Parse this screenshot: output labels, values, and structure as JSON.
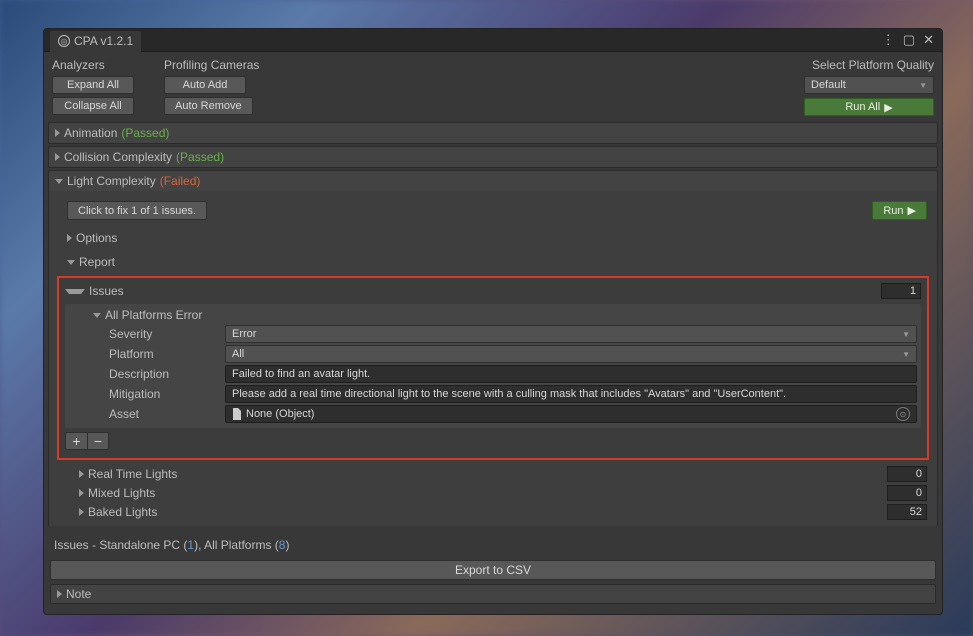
{
  "window": {
    "title": "CPA v1.2.1"
  },
  "toolbar": {
    "analyzers_label": "Analyzers",
    "profiling_label": "Profiling Cameras",
    "expand_all": "Expand All",
    "collapse_all": "Collapse All",
    "auto_add": "Auto Add",
    "auto_remove": "Auto Remove",
    "quality_label": "Select Platform Quality",
    "quality_value": "Default",
    "run_all": "Run All"
  },
  "sections": {
    "animation": {
      "title": "Animation",
      "status": "(Passed)"
    },
    "collision": {
      "title": "Collision Complexity",
      "status": "(Passed)"
    },
    "light": {
      "title": "Light Complexity",
      "status": "(Failed)",
      "fix_btn": "Click to fix 1 of 1 issues.",
      "run_btn": "Run",
      "options_label": "Options",
      "report_label": "Report",
      "issues": {
        "label": "Issues",
        "count": "1",
        "error": {
          "title": "All Platforms Error",
          "severity_label": "Severity",
          "severity_value": "Error",
          "platform_label": "Platform",
          "platform_value": "All",
          "description_label": "Description",
          "description_value": "Failed to find an avatar light.",
          "mitigation_label": "Mitigation",
          "mitigation_value": "Please add a real time directional light to the scene with a culling mask that includes \"Avatars\" and \"UserContent\".",
          "asset_label": "Asset",
          "asset_value": "None (Object)"
        }
      },
      "realtime": {
        "label": "Real Time Lights",
        "count": "0"
      },
      "mixed": {
        "label": "Mixed Lights",
        "count": "0"
      },
      "baked": {
        "label": "Baked Lights",
        "count": "52"
      }
    }
  },
  "footer": {
    "summary_prefix": "Issues - Standalone PC (",
    "pc_count": "1",
    "summary_mid": "), All Platforms (",
    "all_count": "8",
    "summary_suffix": ")",
    "export": "Export to CSV",
    "note": "Note"
  }
}
